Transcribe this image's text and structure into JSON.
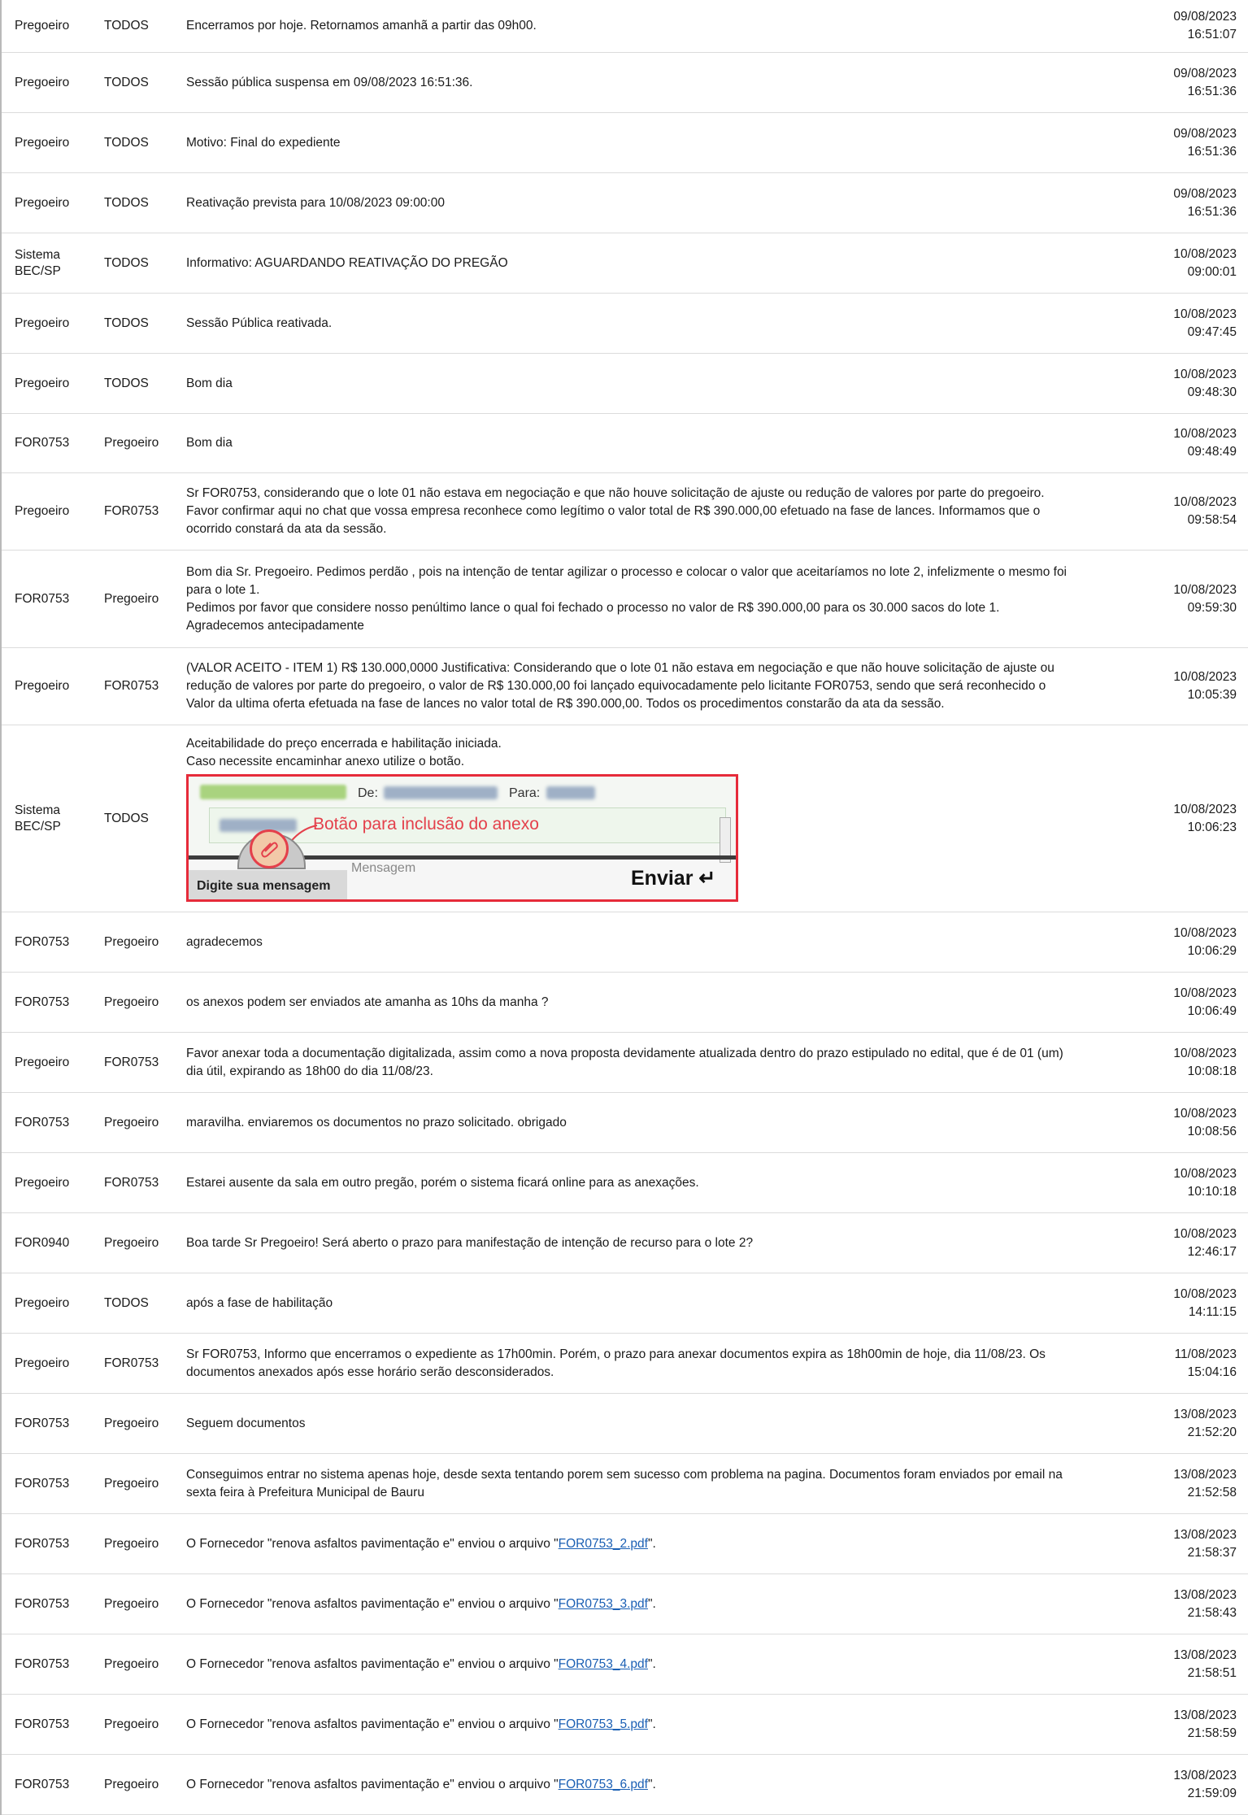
{
  "rows": [
    {
      "from": [
        "Pregoeiro"
      ],
      "to": "TODOS",
      "msg": [
        "Encerramos por hoje. Retornamos amanhã a partir das 09h00."
      ],
      "date": "09/08/2023",
      "time": "16:51:07"
    },
    {
      "from": [
        "Pregoeiro"
      ],
      "to": "TODOS",
      "msg": [
        "Sessão pública suspensa em 09/08/2023 16:51:36."
      ],
      "date": "09/08/2023",
      "time": "16:51:36"
    },
    {
      "from": [
        "Pregoeiro"
      ],
      "to": "TODOS",
      "msg": [
        "Motivo: Final do expediente"
      ],
      "date": "09/08/2023",
      "time": "16:51:36"
    },
    {
      "from": [
        "Pregoeiro"
      ],
      "to": "TODOS",
      "msg": [
        "Reativação prevista para 10/08/2023 09:00:00"
      ],
      "date": "09/08/2023",
      "time": "16:51:36"
    },
    {
      "from": [
        "Sistema",
        "BEC/SP"
      ],
      "to": "TODOS",
      "msg": [
        "Informativo: AGUARDANDO REATIVAÇÃO DO PREGÃO"
      ],
      "date": "10/08/2023",
      "time": "09:00:01"
    },
    {
      "from": [
        "Pregoeiro"
      ],
      "to": "TODOS",
      "msg": [
        "Sessão Pública reativada."
      ],
      "date": "10/08/2023",
      "time": "09:47:45"
    },
    {
      "from": [
        "Pregoeiro"
      ],
      "to": "TODOS",
      "msg": [
        "Bom dia"
      ],
      "date": "10/08/2023",
      "time": "09:48:30"
    },
    {
      "from": [
        "FOR0753"
      ],
      "to": "Pregoeiro",
      "msg": [
        "Bom dia"
      ],
      "date": "10/08/2023",
      "time": "09:48:49"
    },
    {
      "from": [
        "Pregoeiro"
      ],
      "to": "FOR0753",
      "msg": [
        "Sr FOR0753, considerando que o lote 01 não estava em negociação e que não houve solicitação de ajuste ou redução de valores por parte do pregoeiro.",
        "Favor confirmar aqui no chat que vossa empresa reconhece como legítimo o valor total de R$ 390.000,00 efetuado na fase de lances. Informamos que o",
        "ocorrido constará da ata da sessão."
      ],
      "date": "10/08/2023",
      "time": "09:58:54"
    },
    {
      "from": [
        "FOR0753"
      ],
      "to": "Pregoeiro",
      "msg": [
        "Bom dia Sr. Pregoeiro. Pedimos perdão , pois na intenção de tentar agilizar o processo e colocar o valor que aceitaríamos no lote 2, infelizmente o mesmo foi",
        "para o lote 1.",
        "Pedimos por favor que considere nosso penúltimo lance o qual foi fechado o processo no valor de R$ 390.000,00 para os 30.000 sacos do lote 1.",
        "Agradecemos antecipadamente"
      ],
      "date": "10/08/2023",
      "time": "09:59:30"
    },
    {
      "from": [
        "Pregoeiro"
      ],
      "to": "FOR0753",
      "msg": [
        "(VALOR ACEITO - ITEM 1) R$ 130.000,0000 Justificativa: Considerando que o lote 01 não estava em negociação e que não houve solicitação de ajuste ou",
        "redução de valores por parte do pregoeiro, o valor de R$ 130.000,00 foi lançado equivocadamente pelo licitante FOR0753, sendo que será reconhecido o",
        "Valor da ultima oferta efetuada na fase de lances no valor total de R$ 390.000,00. Todos os procedimentos constarão da ata da sessão."
      ],
      "date": "10/08/2023",
      "time": "10:05:39"
    },
    {
      "from": [
        "Sistema",
        "BEC/SP"
      ],
      "to": "TODOS",
      "msg": [
        "Aceitabilidade do preço encerrada e habilitação iniciada.",
        "Caso necessite encaminhar anexo utilize o botão."
      ],
      "date": "10/08/2023",
      "time": "10:06:23",
      "help_image": true
    },
    {
      "from": [
        "FOR0753"
      ],
      "to": "Pregoeiro",
      "msg": [
        "agradecemos"
      ],
      "date": "10/08/2023",
      "time": "10:06:29"
    },
    {
      "from": [
        "FOR0753"
      ],
      "to": "Pregoeiro",
      "msg": [
        "os anexos podem ser enviados ate amanha as 10hs da manha ?"
      ],
      "date": "10/08/2023",
      "time": "10:06:49"
    },
    {
      "from": [
        "Pregoeiro"
      ],
      "to": "FOR0753",
      "msg": [
        "Favor anexar toda a documentação digitalizada, assim como a nova proposta devidamente atualizada dentro do prazo estipulado no edital, que é de 01 (um)",
        "dia útil, expirando as 18h00 do dia 11/08/23."
      ],
      "date": "10/08/2023",
      "time": "10:08:18"
    },
    {
      "from": [
        "FOR0753"
      ],
      "to": "Pregoeiro",
      "msg": [
        "maravilha. enviaremos os documentos no prazo solicitado. obrigado"
      ],
      "date": "10/08/2023",
      "time": "10:08:56"
    },
    {
      "from": [
        "Pregoeiro"
      ],
      "to": "FOR0753",
      "msg": [
        "Estarei ausente da sala em outro pregão, porém o sistema ficará online para as anexações."
      ],
      "date": "10/08/2023",
      "time": "10:10:18"
    },
    {
      "from": [
        "FOR0940"
      ],
      "to": "Pregoeiro",
      "msg": [
        "Boa tarde Sr Pregoeiro! Será aberto o prazo para manifestação de intenção de recurso para o lote 2?"
      ],
      "date": "10/08/2023",
      "time": "12:46:17"
    },
    {
      "from": [
        "Pregoeiro"
      ],
      "to": "TODOS",
      "msg": [
        "após a fase de habilitação"
      ],
      "date": "10/08/2023",
      "time": "14:11:15"
    },
    {
      "from": [
        "Pregoeiro"
      ],
      "to": "FOR0753",
      "msg": [
        "Sr FOR0753, Informo que encerramos o expediente as 17h00min. Porém, o prazo para anexar documentos expira as 18h00min de hoje, dia 11/08/23. Os",
        "documentos anexados após esse horário serão desconsiderados."
      ],
      "date": "11/08/2023",
      "time": "15:04:16"
    },
    {
      "from": [
        "FOR0753"
      ],
      "to": "Pregoeiro",
      "msg": [
        "Seguem documentos"
      ],
      "date": "13/08/2023",
      "time": "21:52:20"
    },
    {
      "from": [
        "FOR0753"
      ],
      "to": "Pregoeiro",
      "msg": [
        "Conseguimos entrar no sistema apenas hoje, desde sexta tentando porem sem sucesso com problema na pagina. Documentos foram enviados por email na",
        "sexta feira à Prefeitura Municipal de Bauru"
      ],
      "date": "13/08/2023",
      "time": "21:52:58"
    },
    {
      "from": [
        "FOR0753"
      ],
      "to": "Pregoeiro",
      "msg_prefix": "O Fornecedor \"renova asfaltos pavimentação e\" enviou o arquivo \"",
      "file": "FOR0753_2.pdf",
      "msg_suffix": "\".",
      "date": "13/08/2023",
      "time": "21:58:37"
    },
    {
      "from": [
        "FOR0753"
      ],
      "to": "Pregoeiro",
      "msg_prefix": "O Fornecedor \"renova asfaltos pavimentação e\" enviou o arquivo \"",
      "file": "FOR0753_3.pdf",
      "msg_suffix": "\".",
      "date": "13/08/2023",
      "time": "21:58:43"
    },
    {
      "from": [
        "FOR0753"
      ],
      "to": "Pregoeiro",
      "msg_prefix": "O Fornecedor \"renova asfaltos pavimentação e\" enviou o arquivo \"",
      "file": "FOR0753_4.pdf",
      "msg_suffix": "\".",
      "date": "13/08/2023",
      "time": "21:58:51"
    },
    {
      "from": [
        "FOR0753"
      ],
      "to": "Pregoeiro",
      "msg_prefix": "O Fornecedor \"renova asfaltos pavimentação e\" enviou o arquivo \"",
      "file": "FOR0753_5.pdf",
      "msg_suffix": "\".",
      "date": "13/08/2023",
      "time": "21:58:59"
    },
    {
      "from": [
        "FOR0753"
      ],
      "to": "Pregoeiro",
      "msg_prefix": "O Fornecedor \"renova asfaltos pavimentação e\" enviou o arquivo \"",
      "file": "FOR0753_6.pdf",
      "msg_suffix": "\".",
      "date": "13/08/2023",
      "time": "21:59:09"
    }
  ],
  "help_image": {
    "from_label": "De:",
    "to_label": "Para:",
    "annotation": "Botão para inclusão do anexo",
    "type_label": "Digite sua mensagem",
    "message_placeholder": "Mensagem",
    "send_label": "Enviar ↵",
    "paperclip_icon": "paperclip-icon",
    "annotation_color": "#e4404b"
  }
}
